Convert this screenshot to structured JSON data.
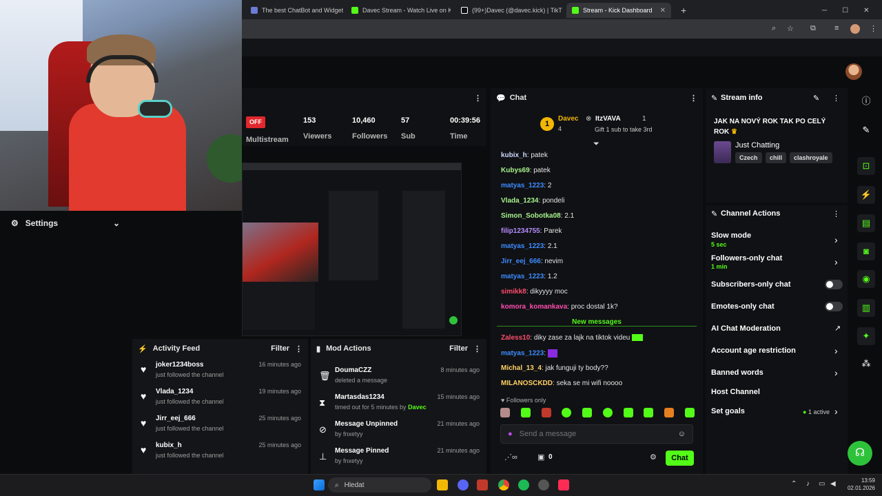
{
  "browser": {
    "tabs": [
      {
        "label": "The best ChatBot and Widgets",
        "color": "#6b7bd6"
      },
      {
        "label": "Davec Stream - Watch Live on K",
        "color": "#53fc18"
      },
      {
        "label": "(99+)Davec (@davec.kick) | TikT",
        "color": "#ffffff"
      },
      {
        "label": "Stream - Kick Dashboard",
        "color": "#53fc18"
      }
    ]
  },
  "settings": {
    "label": "Settings"
  },
  "stats": {
    "status": "OFF",
    "multistream_label": "Multistream",
    "viewers": "153",
    "viewers_label": "Viewers",
    "followers": "10,460",
    "followers_label": "Followers",
    "subs": "57",
    "subs_label": "Sub",
    "time": "00:39:56",
    "time_label": "Time"
  },
  "activity": {
    "title": "Activity Feed",
    "filter": "Filter",
    "items": [
      {
        "name": "joker1234boss",
        "action": "just followed the channel",
        "time": "16 minutes ago"
      },
      {
        "name": "Vlada_1234",
        "action": "just followed the channel",
        "time": "19 minutes ago"
      },
      {
        "name": "Jirr_eej_666",
        "action": "just followed the channel",
        "time": "25 minutes ago"
      },
      {
        "name": "kubix_h",
        "action": "just followed the channel",
        "time": "25 minutes ago"
      }
    ]
  },
  "mod": {
    "title": "Mod Actions",
    "filter": "Filter",
    "items": [
      {
        "icon": "trash-icon",
        "name": "DoumaCZZ",
        "sub": "deleted a message",
        "by": "",
        "time": "8 minutes ago"
      },
      {
        "icon": "hourglass-icon",
        "name": "Martasdas1234",
        "sub": "timed out for 5 minutes by",
        "by": "Davec",
        "time": "15 minutes ago"
      },
      {
        "icon": "unpin-icon",
        "name": "Message Unpinned",
        "sub": "by fnxetyy",
        "by": "",
        "time": "21 minutes ago"
      },
      {
        "icon": "pin-icon",
        "name": "Message Pinned",
        "sub": "by fnxetyy",
        "by": "",
        "time": "21 minutes ago"
      }
    ]
  },
  "chat": {
    "title": "Chat",
    "leader1": {
      "name": "Davec",
      "count": "4"
    },
    "leader2": {
      "name": "ItzVAVA",
      "count": "1",
      "note": "Gift 1 sub to take 3rd"
    },
    "messages": [
      {
        "user": "kubix_h",
        "color": "#d0d6ff",
        "text": "patek"
      },
      {
        "user": "Kubys69",
        "color": "#a6f28c",
        "text": "patek"
      },
      {
        "user": "matyas_1223",
        "color": "#3d8cff",
        "text": "2"
      },
      {
        "user": "Vlada_1234",
        "color": "#a6f28c",
        "text": "pondeli"
      },
      {
        "user": "Simon_Sobotka08",
        "color": "#a6f28c",
        "text": "2.1"
      },
      {
        "user": "filip1234755",
        "color": "#b58cff",
        "text": "Parek"
      },
      {
        "user": "matyas_1223",
        "color": "#3d8cff",
        "text": "2.1"
      },
      {
        "user": "Jirr_eej_666",
        "color": "#3d8cff",
        "text": "nevim"
      },
      {
        "user": "matyas_1223",
        "color": "#3d8cff",
        "text": "1.2"
      },
      {
        "user": "simikk8",
        "color": "#ff4d6d",
        "text": "dikyyyy moc"
      },
      {
        "user": "komora_komankava",
        "color": "#ff4fb0",
        "text": "proc dostal 1k?"
      }
    ],
    "new_messages_label": "New messages",
    "new_messages": [
      {
        "user": "Zaless10",
        "color": "#ff4d6d",
        "text": "diky zase za lajk na tiktok videu"
      },
      {
        "user": "matyas_1223",
        "color": "#3d8cff",
        "text": ""
      },
      {
        "user": "Michal_13_4",
        "color": "#ffd166",
        "text": "jak funguji ty body??"
      },
      {
        "user": "MILANOSCKDD",
        "color": "#ffd166",
        "text": "seka se mi wifi noooo"
      }
    ],
    "followers_only": "Followers only",
    "input_placeholder": "Send a message",
    "points": "0",
    "send_label": "Chat"
  },
  "stream_info": {
    "title_label": "Stream info",
    "stream_title": "JAK NA NOVÝ ROK TAK PO CELÝ ROK",
    "category": "Just Chatting",
    "tags": [
      "Czech",
      "chill",
      "clashroyale"
    ]
  },
  "channel_actions": {
    "title": "Channel Actions",
    "slow_mode": "Slow mode",
    "slow_mode_value": "5 sec",
    "followers_only": "Followers-only chat",
    "followers_only_value": "1 min",
    "subscribers_only": "Subscribers-only chat",
    "emotes_only": "Emotes-only chat",
    "ai_moderation": "AI Chat Moderation",
    "age_restriction": "Account age restriction",
    "banned_words": "Banned words",
    "host_channel": "Host Channel",
    "set_goals": "Set goals",
    "goals_active": "1 active"
  },
  "taskbar": {
    "search_placeholder": "Hledat",
    "time": "13:59",
    "date": "02.01.2026"
  }
}
